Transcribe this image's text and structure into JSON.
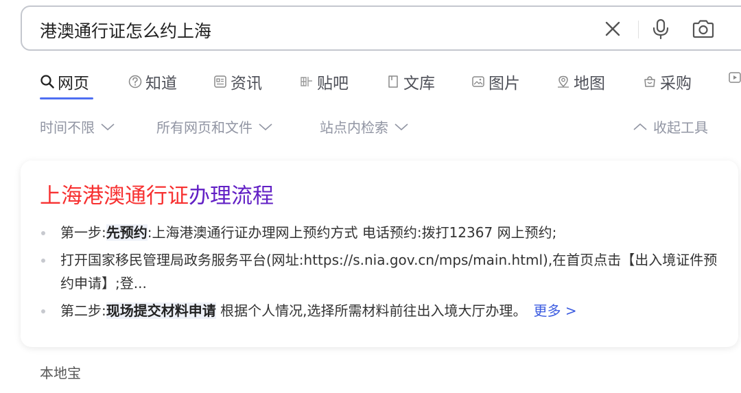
{
  "search": {
    "query": "港澳通行证怎么约上海"
  },
  "tabs": [
    {
      "label": "网页",
      "icon": "search-icon"
    },
    {
      "label": "知道",
      "icon": "question-icon"
    },
    {
      "label": "资讯",
      "icon": "news-icon"
    },
    {
      "label": "贴吧",
      "icon": "tieba-icon"
    },
    {
      "label": "文库",
      "icon": "document-icon"
    },
    {
      "label": "图片",
      "icon": "image-icon"
    },
    {
      "label": "地图",
      "icon": "map-icon"
    },
    {
      "label": "采购",
      "icon": "shopping-icon"
    }
  ],
  "filters": {
    "time": "时间不限",
    "filetype": "所有网页和文件",
    "site": "站点内检索",
    "collapse": "收起工具"
  },
  "result": {
    "title_highlight": "上海港澳通行证",
    "title_rest": "办理流程",
    "items": [
      {
        "prefix": "第一步:",
        "bold": "先预约",
        "text": ":上海港澳通行证办理网上预约方式 电话预约:拨打12367 网上预约;"
      },
      {
        "prefix": "",
        "bold": "",
        "text": "打开国家移民管理局政务服务平台(网址:https://s.nia.gov.cn/mps/main.html),在首页点击【出入境证件预约申请】;登..."
      },
      {
        "prefix": "第二步:",
        "bold": "现场提交材料申请",
        "text": " 根据个人情况,选择所需材料前往出入境大厅办理。"
      }
    ],
    "more": "更多 >"
  },
  "footer": {
    "label": "本地宝"
  },
  "colors": {
    "accent": "#4e6ef2",
    "title_red": "#f73131",
    "title_purple": "#6220c5",
    "link_blue": "#3b5be0"
  }
}
